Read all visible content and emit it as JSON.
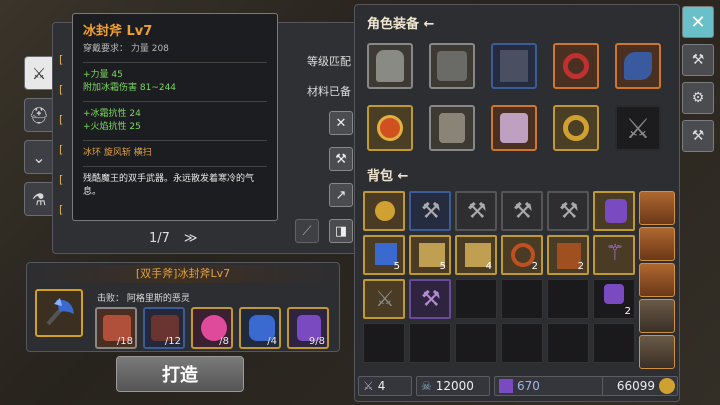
{
  "tooltip": {
    "title": "冰封斧 Lv7",
    "requirement": "穿戴要求：  力量 208",
    "stat_str": "+力量 45",
    "stat_dmg": "附加冰霜伤害 81~244",
    "res_ice": "+冰霜抗性 24",
    "res_fire": "+火焰抗性 25",
    "skills": "冰环   旋风斩   横扫",
    "desc": "残酷魔王的双手武器。永远散发着寒冷的气息。"
  },
  "recipe_list": {
    "right_label_1": "等级匹配",
    "right_label_2": "材料已备",
    "page": "1/7",
    "next_icon": "≫"
  },
  "craft": {
    "title": "[双手斧]冰封斧Lv7",
    "requirement": "击败：  阿格里斯的恶灵",
    "materials": [
      {
        "count": "/18"
      },
      {
        "count": "/12"
      },
      {
        "count": "/8"
      },
      {
        "count": "/4"
      },
      {
        "count": "9/8"
      }
    ],
    "forge_label": "打造"
  },
  "inventory": {
    "equip_title": "角色装备",
    "bag_title": "背包",
    "bag_counts": [
      "5",
      "5",
      "4",
      "2",
      "2",
      "2"
    ]
  },
  "currency": {
    "attack": "4",
    "soul": "12000",
    "gem": "670",
    "gold": "66099"
  },
  "colors": {
    "accent_gold": "#e0a040",
    "stat_green": "#7cd860",
    "close_teal": "#6ac0c8"
  }
}
